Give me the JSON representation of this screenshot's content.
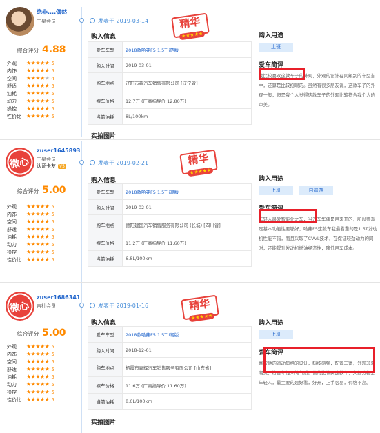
{
  "labels": {
    "score": "综合评分",
    "date_prefix": "发表于",
    "purchase_info": "购入信息",
    "photos": "实拍图片",
    "usage": "购入用途",
    "comment": "爱车简评",
    "jing": "精华",
    "jing_stars": "★★★★★",
    "field_model": "爱车车型",
    "field_time": "购入时间",
    "field_place": "购车地点",
    "field_price": "裸车价格",
    "field_fuel": "当前油耗"
  },
  "rating_labels": [
    "外观",
    "内饰",
    "空间",
    "舒适",
    "油耗",
    "动力",
    "操控",
    "性价比"
  ],
  "reviews": [
    {
      "username": "绝非....偶然",
      "level": "三星会员",
      "cert": "",
      "score": "4.88",
      "ratings": [
        "5",
        "5",
        "4",
        "5",
        "5",
        "5",
        "5",
        "5"
      ],
      "date": "2019-03-14",
      "model": "2018款哈弗F5 1.5T i范版",
      "time": "2019-03-01",
      "place": "辽阳市鑫汽车销售有限公司 [辽宁省]",
      "price": "12.7万 (厂商指导价 12.80万)",
      "fuel": "8L/100km",
      "tags": [
        "上班"
      ],
      "comment": "我比较喜欢这款车子的外观，外观的设计在同级别的车型当中，还算是比较抢眼的。虽然有很多朋友说，这款车子的外观一般，但是我个人觉得这款车子的外观比较符合我个人的审美。"
    },
    {
      "username": "zuser1645893",
      "level": "三星会员",
      "cert": "认证卡友",
      "cert_badge": "V5",
      "score": "5.00",
      "ratings": [
        "5",
        "5",
        "5",
        "5",
        "5",
        "5",
        "5",
        "5"
      ],
      "date": "2019-02-21",
      "model": "2018款哈弗F5 1.5T i潮版",
      "time": "2019-02-01",
      "place": "德阳建国汽车销售服务有限公司 (长城) [四川省]",
      "price": "11.2万 (厂商指导价 11.60万)",
      "fuel": "6.8L/100km",
      "tags": [
        "上班",
        "自驾游"
      ],
      "comment": "年轻人最爱智能化之车，当汽车华偶是用来开的，所以要满足基本功能性要够好，哈弗F5这款车我最看重的是1.5T发动机性能不错，而且采取了CVVL技术，在保证较劲动力的同时，还能提升发动机燃油经济性，降低用车成本。"
    },
    {
      "username": "zuser1686341",
      "level": "吉社会员",
      "cert": "",
      "score": "5.00",
      "ratings": [
        "5",
        "5",
        "5",
        "5",
        "5",
        "5",
        "5",
        "5"
      ],
      "date": "2019-01-16",
      "model": "2018款哈弗F5 1.5T i潮版",
      "time": "2018-12-01",
      "place": "栖霞市嘉辉汽车销售服务有限公司 [山东省]",
      "price": "11.6万 (厂商指导价 11.60万)",
      "fuel": "8.6L/100km",
      "tags": [
        "上班"
      ],
      "comment": "喜欢他的运动风格的设计，科技感强，配置丰富，外观非常潮流，符合年轻人的气质。偏的比较买这款车，大部分都是年轻人，最主要的是好看，好开，上手容易，价格不高。"
    }
  ]
}
